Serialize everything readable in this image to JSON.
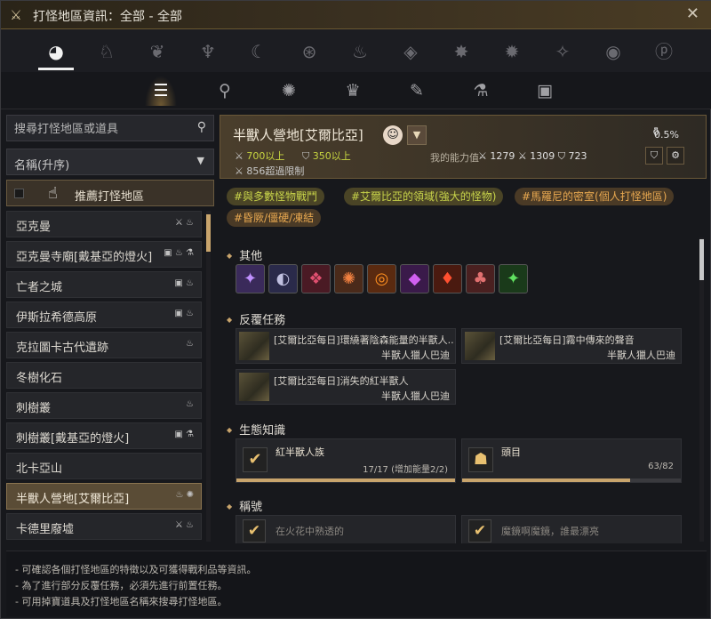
{
  "window": {
    "title": "打怪地區資訊：全部 - 全部",
    "close": "✕",
    "icon": "crossed-swords-icon"
  },
  "tabs_primary": [
    {
      "icon": "globe-icon",
      "glyph": "◕"
    },
    {
      "icon": "horse-icon",
      "glyph": "♘"
    },
    {
      "icon": "beast-head-icon",
      "glyph": "❦"
    },
    {
      "icon": "demon-icon",
      "glyph": "♆"
    },
    {
      "icon": "moon-icon",
      "glyph": "☾"
    },
    {
      "icon": "compass-icon",
      "glyph": "⊛"
    },
    {
      "icon": "flame-icon",
      "glyph": "♨"
    },
    {
      "icon": "drop-icon",
      "glyph": "◈"
    },
    {
      "icon": "star-icon",
      "glyph": "✸"
    },
    {
      "icon": "sun-icon",
      "glyph": "✹"
    },
    {
      "icon": "shine-icon",
      "glyph": "✧"
    },
    {
      "icon": "eye-icon",
      "glyph": "◉"
    },
    {
      "icon": "rune-icon",
      "glyph": "ⓟ"
    }
  ],
  "tabs_secondary": [
    {
      "icon": "list-icon",
      "glyph": "☰"
    },
    {
      "icon": "magnify-icon",
      "glyph": "⚲"
    },
    {
      "icon": "gear-monster-icon",
      "glyph": "✺"
    },
    {
      "icon": "crown-icon",
      "glyph": "♛"
    },
    {
      "icon": "scroll-icon",
      "glyph": "✎"
    },
    {
      "icon": "potion-icon",
      "glyph": "⚗"
    },
    {
      "icon": "picture-icon",
      "glyph": "▣"
    }
  ],
  "search": {
    "placeholder": "搜尋打怪地區或道具"
  },
  "sort": {
    "label": "名稱(升序)"
  },
  "recommend": {
    "label": "推薦打怪地區"
  },
  "zones": [
    {
      "name": "亞克曼",
      "icons": "⚔ ♨"
    },
    {
      "name": "亞克曼寺廟[戴基亞的燈火]",
      "icons": "▣ ♨ ⚗"
    },
    {
      "name": "亡者之城",
      "icons": "▣ ♨"
    },
    {
      "name": "伊斯拉希德高原",
      "icons": "▣ ♨"
    },
    {
      "name": "克拉圖卡古代遺跡",
      "icons": "♨"
    },
    {
      "name": "冬樹化石",
      "icons": ""
    },
    {
      "name": "刺樹叢",
      "icons": "♨"
    },
    {
      "name": "刺樹叢[戴基亞的燈火]",
      "icons": "▣ ⚗"
    },
    {
      "name": "北卡亞山",
      "icons": ""
    },
    {
      "name": "半獸人營地[艾爾比亞]",
      "icons": "♨ ✺"
    },
    {
      "name": "卡德里廢墟",
      "icons": "⚔ ♨"
    }
  ],
  "header": {
    "name": "半獸人營地[艾爾比亞]",
    "face": "☺",
    "dropdown": "▼",
    "percent": "0.5%",
    "ap": "700以上",
    "dp": "350以上",
    "ap_icon": "⚔",
    "dp_icon": "⛉",
    "limit": "856超過限制",
    "my_label": "我的能力值",
    "my_stats": "⚔ 1279   ⚔ 1309   ⛉ 723",
    "btn1": "⛉",
    "btn2": "⚙"
  },
  "tags": [
    "#與多數怪物戰鬥",
    "#艾爾比亞的領域(強大的怪物)",
    "#馬羅尼的密室(個人打怪地區)",
    "#昏厥/僵硬/凍結"
  ],
  "sections": {
    "other": "其他",
    "quests": "反覆任務",
    "ecology": "生態知識",
    "titles": "稱號"
  },
  "items": [
    {
      "icon": "purple-crystal-icon",
      "glyph": "✦",
      "bg": "#3a2a5a",
      "fg": "#c090ff"
    },
    {
      "icon": "dark-orb-icon",
      "glyph": "◐",
      "bg": "#2a2a4a",
      "fg": "#c0c0e0"
    },
    {
      "icon": "red-shard-icon",
      "glyph": "❖",
      "bg": "#4a1a24",
      "fg": "#e05070"
    },
    {
      "icon": "ember-icon",
      "glyph": "✺",
      "bg": "#4a2a1a",
      "fg": "#f08040"
    },
    {
      "icon": "fire-ring-icon",
      "glyph": "◎",
      "bg": "#5a2a10",
      "fg": "#ff9020"
    },
    {
      "icon": "violet-gem-icon",
      "glyph": "◆",
      "bg": "#3a1a4a",
      "fg": "#d060f0"
    },
    {
      "icon": "flame-gem-icon",
      "glyph": "♦",
      "bg": "#4a1a10",
      "fg": "#ff5030"
    },
    {
      "icon": "red-mushroom-icon",
      "glyph": "♣",
      "bg": "#4a2020",
      "fg": "#e07070"
    },
    {
      "icon": "green-crystal-icon",
      "glyph": "✦",
      "bg": "#1a3a1a",
      "fg": "#60e060"
    }
  ],
  "quests": [
    {
      "name": "[艾爾比亞每日]環繞著陰森能量的半獸人...",
      "giver": "半獸人獵人巴迪"
    },
    {
      "name": "[艾爾比亞每日]霧中傳來的聲音",
      "giver": "半獸人獵人巴迪"
    },
    {
      "name": "[艾爾比亞每日]消失的紅半獸人",
      "giver": "半獸人獵人巴迪"
    }
  ],
  "ecology": [
    {
      "name": "紅半獸人族",
      "value": "17/17 (增加能量2/2)",
      "check": "✔",
      "progress": 1.0
    },
    {
      "name": "頭目",
      "value": "63/82",
      "check": "☗",
      "progress": 0.77
    }
  ],
  "titles": [
    {
      "name": "在火花中熟透的",
      "check": "✔"
    },
    {
      "name": "魔鏡啊魔鏡，誰最漂亮",
      "check": "✔"
    }
  ],
  "footer": [
    "- 可確認各個打怪地區的特徵以及可獲得戰利品等資訊。",
    "- 為了進行部分反覆任務，必須先進行前置任務。",
    "- 可用掉寶道具及打怪地區名稱來搜尋打怪地區。"
  ]
}
